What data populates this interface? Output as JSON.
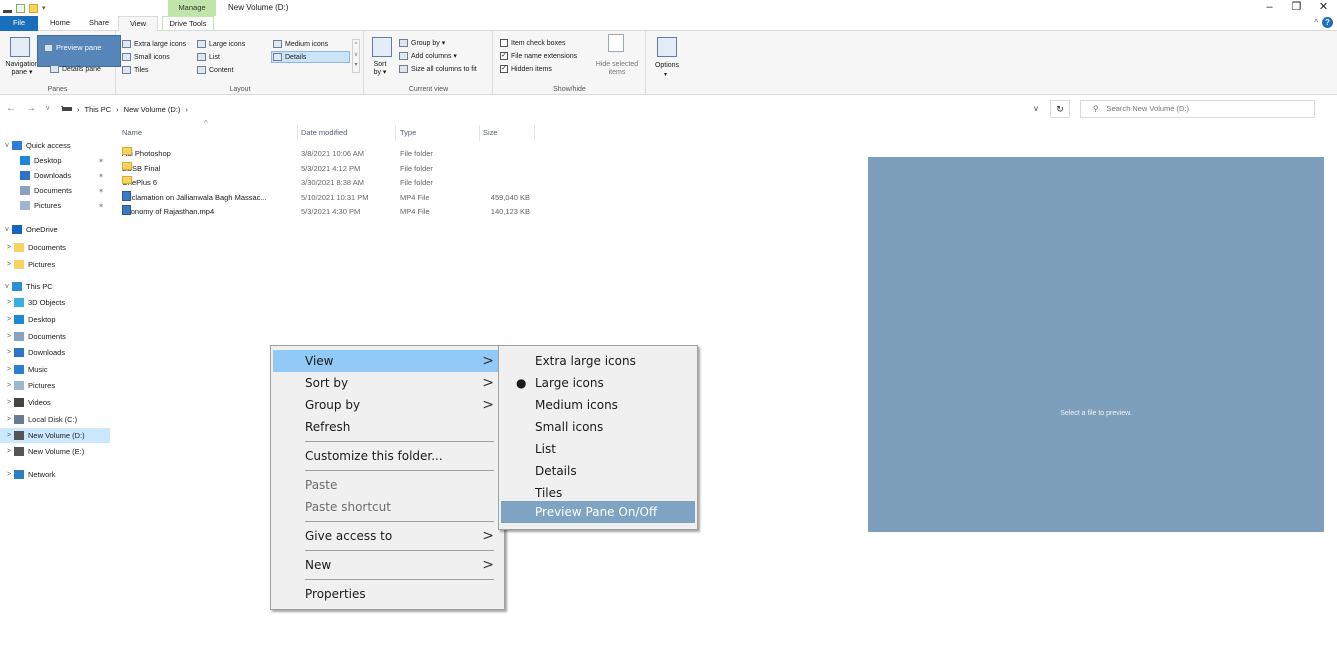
{
  "window": {
    "title": "New Volume (D:)",
    "context_tab": "Manage",
    "controls": {
      "minimize": "–",
      "restore": "❐",
      "close": "✕"
    }
  },
  "tabs": {
    "file": "File",
    "home": "Home",
    "share": "Share",
    "view": "View",
    "drive_tools": "Drive Tools"
  },
  "ribbon": {
    "panes": {
      "navigation_pane": "Navigation pane ▾",
      "preview_pane": "Preview pane",
      "details_pane": "Details pane",
      "label": "Panes"
    },
    "layout": {
      "extra_large_icons": "Extra large icons",
      "large_icons": "Large icons",
      "medium_icons": "Medium icons",
      "small_icons": "Small icons",
      "list": "List",
      "details": "Details",
      "tiles": "Tiles",
      "content": "Content",
      "label": "Layout"
    },
    "current_view": {
      "sort_by": "Sort by ▾",
      "group_by": "Group by ▾",
      "add_columns": "Add columns ▾",
      "size_all_columns": "Size all columns to fit",
      "label": "Current view"
    },
    "show_hide": {
      "item_check_boxes": "Item check boxes",
      "file_name_extensions": "File name extensions",
      "hidden_items": "Hidden items",
      "hide_selected_items": "Hide selected items",
      "label": "Show/hide",
      "checked": {
        "item_check_boxes": false,
        "file_name_extensions": true,
        "hidden_items": true
      }
    },
    "options": "Options"
  },
  "address": {
    "crumbs": [
      "This PC",
      "New Volume (D:)"
    ],
    "separator": "›",
    "search_placeholder": "Search New Volume (D:)"
  },
  "nav": {
    "items": [
      {
        "label": "Quick access",
        "chevron": "v",
        "pinned": false
      },
      {
        "label": "Desktop",
        "chevron": "",
        "pinned": true
      },
      {
        "label": "Downloads",
        "chevron": "",
        "pinned": true
      },
      {
        "label": "Documents",
        "chevron": "",
        "pinned": true
      },
      {
        "label": "Pictures",
        "chevron": "",
        "pinned": true
      },
      {
        "label": "OneDrive",
        "chevron": "v",
        "pinned": false
      },
      {
        "label": "Documents",
        "chevron": ">",
        "pinned": false
      },
      {
        "label": "Pictures",
        "chevron": ">",
        "pinned": false
      },
      {
        "label": "This PC",
        "chevron": "v",
        "pinned": false
      },
      {
        "label": "3D Objects",
        "chevron": ">",
        "pinned": false
      },
      {
        "label": "Desktop",
        "chevron": ">",
        "pinned": false
      },
      {
        "label": "Documents",
        "chevron": ">",
        "pinned": false
      },
      {
        "label": "Downloads",
        "chevron": ">",
        "pinned": false
      },
      {
        "label": "Music",
        "chevron": ">",
        "pinned": false
      },
      {
        "label": "Pictures",
        "chevron": ">",
        "pinned": false
      },
      {
        "label": "Videos",
        "chevron": ">",
        "pinned": false
      },
      {
        "label": "Local Disk (C:)",
        "chevron": ">",
        "pinned": false
      },
      {
        "label": "New Volume (D:)",
        "chevron": ">",
        "pinned": false
      },
      {
        "label": "New Volume (E:)",
        "chevron": ">",
        "pinned": false
      },
      {
        "label": "Network",
        "chevron": ">",
        "pinned": false
      }
    ]
  },
  "files": {
    "columns": {
      "name": "Name",
      "date": "Date modified",
      "type": "Type",
      "size": "Size"
    },
    "rows": [
      {
        "name": "Adi Photoshop",
        "date": "3/8/2021 10:06 AM",
        "type": "File folder",
        "size": ""
      },
      {
        "name": "EBSB Final",
        "date": "5/3/2021 4:12 PM",
        "type": "File folder",
        "size": ""
      },
      {
        "name": "OnePlus 6",
        "date": "3/30/2021 8:38 AM",
        "type": "File folder",
        "size": ""
      },
      {
        "name": "Declamation on Jallianwala Bagh Massac...",
        "date": "5/10/2021 10:31 PM",
        "type": "MP4 File",
        "size": "459,040 KB"
      },
      {
        "name": "Economy of Rajasthan.mp4",
        "date": "5/3/2021 4:30 PM",
        "type": "MP4 File",
        "size": "140,123 KB"
      }
    ]
  },
  "preview": {
    "message": "Select a file to preview."
  },
  "context_menu": {
    "view": "View",
    "sort_by": "Sort by",
    "group_by": "Group by",
    "refresh": "Refresh",
    "customize": "Customize this folder...",
    "paste": "Paste",
    "paste_shortcut": "Paste shortcut",
    "give_access": "Give access to",
    "new": "New",
    "properties": "Properties"
  },
  "view_submenu": {
    "extra_large_icons": "Extra large icons",
    "large_icons": "Large icons",
    "medium_icons": "Medium icons",
    "small_icons": "Small icons",
    "list": "List",
    "details": "Details",
    "tiles": "Tiles",
    "preview_pane": "Preview Pane On/Off",
    "selected": "Large icons"
  },
  "colors": {
    "file_tab": "#1a6fbd",
    "manage_tab": "#bfe6a8",
    "preview_pane": "#7d9fbb",
    "submenu_highlight": "#7ea3c3",
    "selected_nav": "#cce8ff"
  }
}
